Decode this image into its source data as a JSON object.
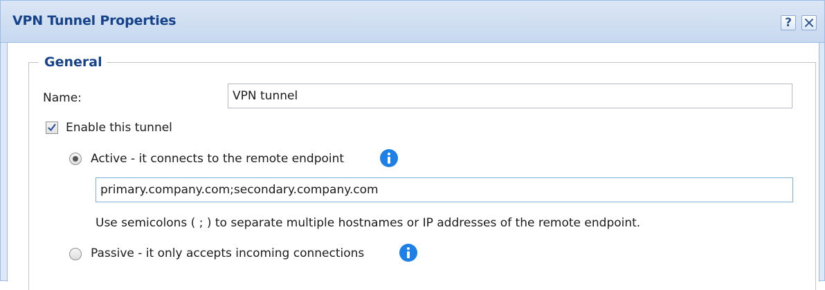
{
  "window": {
    "title": "VPN Tunnel Properties",
    "help_label": "?",
    "close_icon": "close-icon"
  },
  "general": {
    "legend": "General",
    "name_label": "Name:",
    "name_value": "VPN tunnel",
    "enable_label": "Enable this tunnel",
    "enable_checked": true,
    "active_label": "Active - it connects to the remote endpoint",
    "active_selected": true,
    "endpoint_value": "primary.company.com;secondary.company.com",
    "endpoint_hint": "Use semicolons ( ; ) to separate multiple hostnames or IP addresses of the remote endpoint.",
    "passive_label": "Passive - it only accepts incoming connections",
    "passive_selected": false
  },
  "colors": {
    "title_text": "#15428b",
    "window_border": "#99bbe8",
    "info_icon": "#1e7fe6",
    "focus_border": "#7eadd9"
  }
}
